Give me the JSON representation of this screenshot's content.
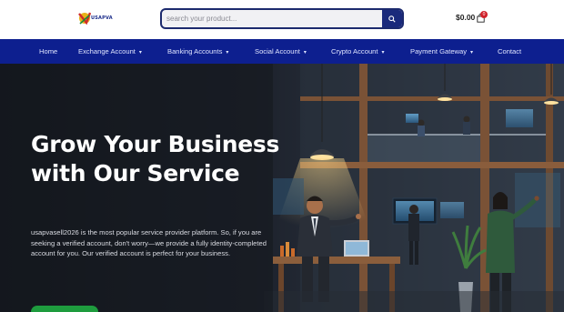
{
  "logo": {
    "text": "USAPVA"
  },
  "search": {
    "placeholder": "search your product..."
  },
  "cart": {
    "amount": "$0.00",
    "count": "0"
  },
  "nav": {
    "items": [
      {
        "label": "Home",
        "dropdown": false
      },
      {
        "label": "Exchange Account",
        "dropdown": true
      },
      {
        "label": "Banking Accounts",
        "dropdown": true
      },
      {
        "label": "Social Account",
        "dropdown": true
      },
      {
        "label": "Crypto Account",
        "dropdown": true
      },
      {
        "label": "Payment Gateway",
        "dropdown": true
      },
      {
        "label": "Contact",
        "dropdown": false
      }
    ]
  },
  "hero": {
    "title_line1": "Grow Your Business",
    "title_line2": "with Our Service",
    "description": "usapvasell2026 is the most popular service provider platform. So, if you are seeking a verified account, don't worry—we provide a fully identity-completed account for you. Our verified account is perfect for your business."
  },
  "colors": {
    "nav_bg": "#0d1f8f",
    "search_border": "#1c2a6e",
    "search_button": "#1a2a7c",
    "cart_badge": "#d0212a",
    "cta_green": "#1e9c3e"
  },
  "icons": [
    "search-icon",
    "shopping-bag-icon",
    "chevron-down-icon"
  ]
}
